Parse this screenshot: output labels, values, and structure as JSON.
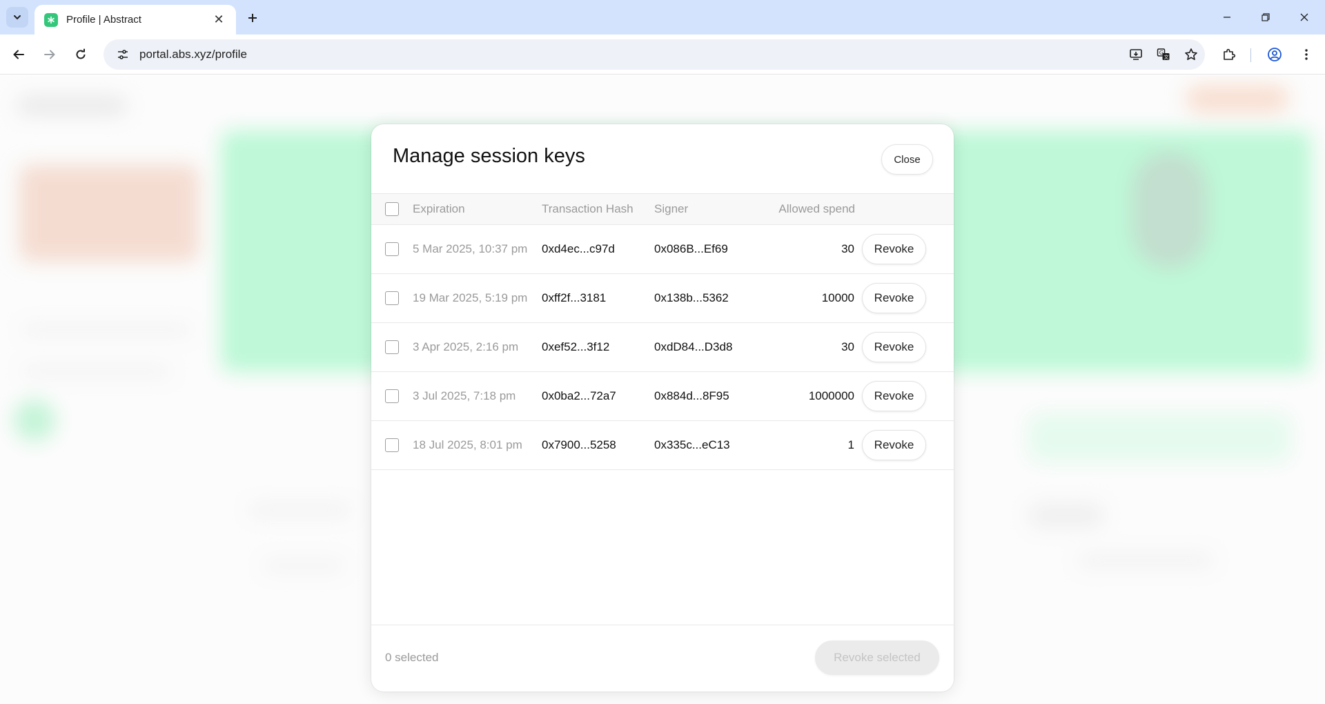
{
  "browser": {
    "tab_title": "Profile | Abstract",
    "url": "portal.abs.xyz/profile"
  },
  "icons": {
    "tab_search": "chevron-down-icon",
    "tab_close": "close-icon",
    "new_tab": "plus-icon",
    "back": "arrow-left-icon",
    "forward": "arrow-right-icon",
    "reload": "reload-icon",
    "site_info": "tune-icon",
    "install": "install-app-icon",
    "translate": "translate-icon",
    "bookmark": "star-icon",
    "extensions": "puzzle-icon",
    "profile": "account-icon",
    "menu": "more-vertical-icon"
  },
  "colors": {
    "tabstrip": "#d3e3fd",
    "brand_green": "#34c77b",
    "background_green": "#6ff0a8",
    "background_peach": "#e8b29a"
  },
  "modal": {
    "title": "Manage session keys",
    "close_label": "Close",
    "columns": {
      "expiration": "Expiration",
      "hash": "Transaction Hash",
      "signer": "Signer",
      "spend": "Allowed spend"
    },
    "rows": [
      {
        "expiration": "5 Mar 2025, 10:37 pm",
        "hash": "0xd4ec...c97d",
        "signer": "0x086B...Ef69",
        "spend": "30",
        "action": "Revoke"
      },
      {
        "expiration": "19 Mar 2025, 5:19 pm",
        "hash": "0xff2f...3181",
        "signer": "0x138b...5362",
        "spend": "10000",
        "action": "Revoke"
      },
      {
        "expiration": "3 Apr 2025, 2:16 pm",
        "hash": "0xef52...3f12",
        "signer": "0xdD84...D3d8",
        "spend": "30",
        "action": "Revoke"
      },
      {
        "expiration": "3 Jul 2025, 7:18 pm",
        "hash": "0x0ba2...72a7",
        "signer": "0x884d...8F95",
        "spend": "1000000",
        "action": "Revoke"
      },
      {
        "expiration": "18 Jul 2025, 8:01 pm",
        "hash": "0x7900...5258",
        "signer": "0x335c...eC13",
        "spend": "1",
        "action": "Revoke"
      }
    ],
    "selected_text": "0 selected",
    "revoke_selected_label": "Revoke selected"
  }
}
